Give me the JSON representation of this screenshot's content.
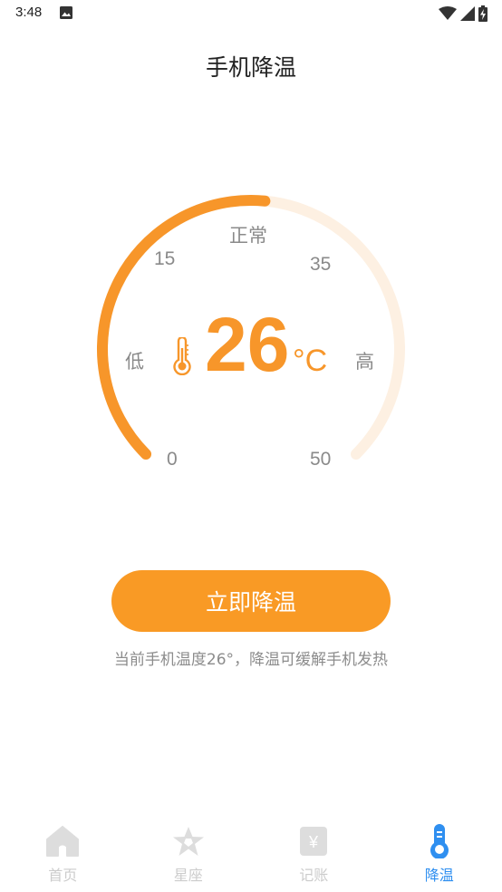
{
  "status_bar": {
    "time": "3:48",
    "icons": [
      "image-icon",
      "wifi-icon",
      "signal-icon",
      "battery-charging-icon"
    ]
  },
  "title": "手机降温",
  "gauge": {
    "labels": {
      "normal": "正常",
      "low": "低",
      "high": "高",
      "t0": "0",
      "t15": "15",
      "t35": "35",
      "t50": "50"
    },
    "value": "26",
    "unit": "°C",
    "min": 0,
    "max": 50,
    "current": 26,
    "accent_color": "#f7962a",
    "track_color": "#fdf0e2"
  },
  "action": {
    "button_label": "立即降温",
    "hint": "当前手机温度26°，降温可缓解手机发热"
  },
  "nav": {
    "items": [
      {
        "label": "首页",
        "icon": "home-icon",
        "active": false
      },
      {
        "label": "星座",
        "icon": "star-icon",
        "active": false
      },
      {
        "label": "记账",
        "icon": "ledger-icon",
        "active": false
      },
      {
        "label": "降温",
        "icon": "thermometer-icon",
        "active": true
      }
    ],
    "active_color": "#2f8ff0",
    "inactive_color": "#cccccc"
  }
}
